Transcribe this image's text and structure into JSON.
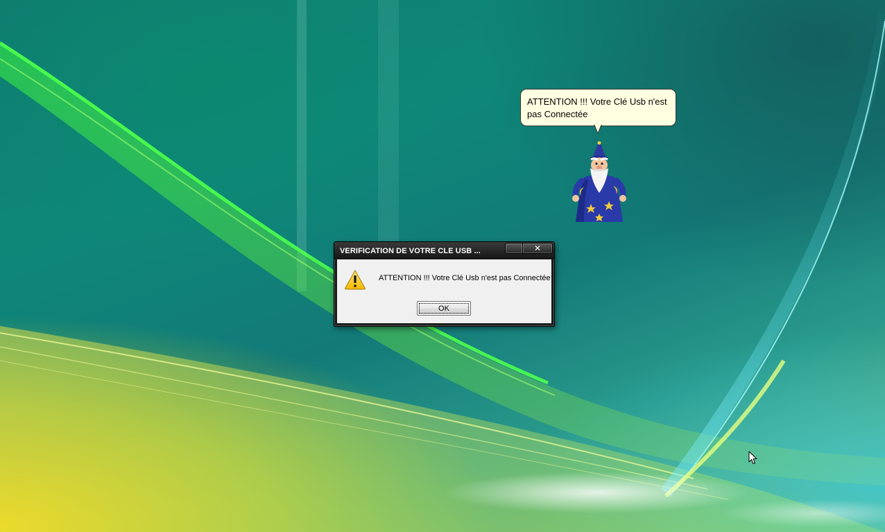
{
  "desktop": {
    "wallpaper": "Windows Vista Aurora",
    "accent_colors": [
      "#0e8779",
      "#2fd04a",
      "#e8d21c",
      "#48c8e0"
    ]
  },
  "assistant": {
    "name_icon": "wizard-icon",
    "balloon_text": "ATTENTION !!! Votre Clé Usb n'est pas Connectée"
  },
  "dialog": {
    "title": "VERIFICATION DE VOTRE CLE USB ...",
    "icon": "warning-icon",
    "message": "ATTENTION !!! Votre Clé Usb n'est pas Connectée",
    "ok_label": "OK",
    "close_glyph": "✕"
  },
  "cursor": {
    "icon": "mouse-pointer-icon"
  }
}
